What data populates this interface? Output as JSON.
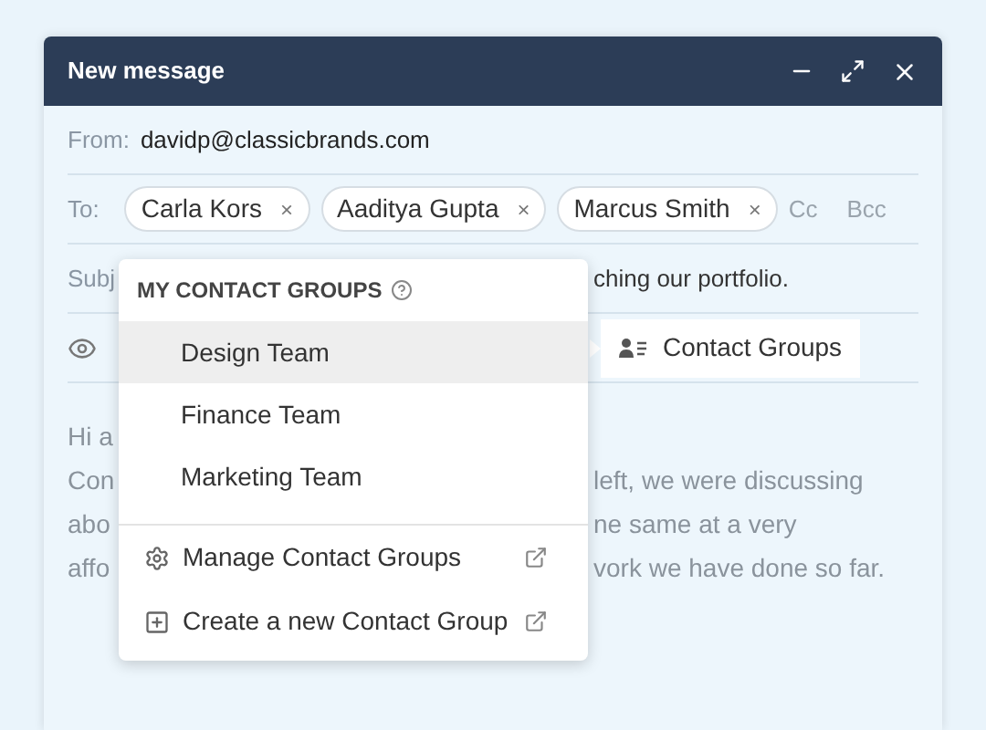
{
  "window": {
    "title": "New message"
  },
  "from": {
    "label": "From:",
    "value": "davidp@classicbrands.com"
  },
  "to": {
    "label": "To:",
    "recipients": [
      "Carla Kors",
      "Aaditya Gupta",
      "Marcus Smith"
    ],
    "remove": "×",
    "cc": "Cc",
    "bcc": "Bcc"
  },
  "subject": {
    "left_fragment": "Subj",
    "right_fragment": "ching our portfolio."
  },
  "toolbar": {
    "contact_groups_button": "Contact Groups"
  },
  "body_lines": [
    {
      "left": "Hi a"
    },
    {
      "left": "Con",
      "right": "left, we were discussing"
    },
    {
      "left": "abo",
      "right": "ne same at a very"
    },
    {
      "left": "affo",
      "right": "vork we have done so far."
    }
  ],
  "menu": {
    "heading": "MY CONTACT GROUPS",
    "groups": [
      {
        "label": "Design Team",
        "selected": true
      },
      {
        "label": "Finance Team",
        "selected": false
      },
      {
        "label": "Marketing Team",
        "selected": false
      }
    ],
    "actions": [
      {
        "kind": "manage",
        "label": "Manage Contact Groups"
      },
      {
        "kind": "create",
        "label": "Create a new Contact Group"
      }
    ]
  }
}
